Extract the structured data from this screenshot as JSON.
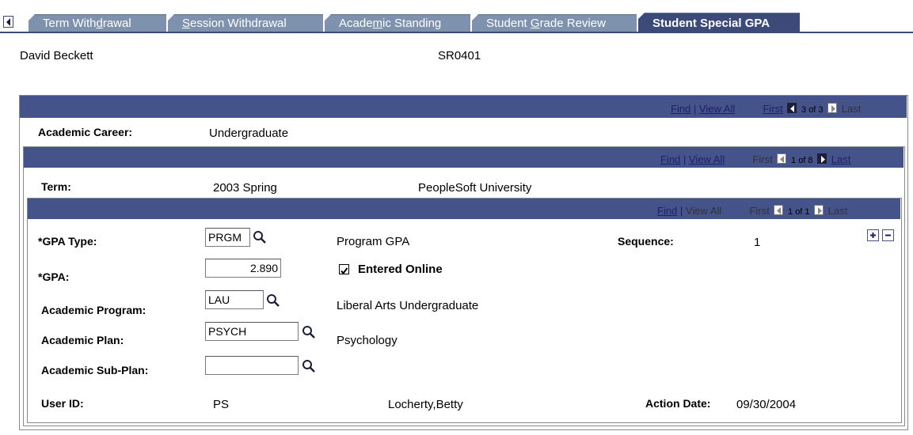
{
  "tabs": [
    {
      "pre": "Term With",
      "u": "d",
      "post": "rawal"
    },
    {
      "pre": "",
      "u": "S",
      "post": "ession Withdrawal"
    },
    {
      "pre": "Acade",
      "u": "m",
      "post": "ic Standing"
    },
    {
      "pre": "Student ",
      "u": "G",
      "post": "rade Review"
    },
    {
      "pre": "Student Special GPA",
      "u": "",
      "post": ""
    }
  ],
  "student": {
    "name": "David Beckett",
    "id": "SR0401"
  },
  "career_grid": {
    "find": "Find",
    "sep": "|",
    "view_all": "View All",
    "first": "First",
    "count": "3 of 3",
    "last": "Last",
    "label": "Academic Career:",
    "value": "Undergraduate"
  },
  "term_grid": {
    "find": "Find",
    "sep": "|",
    "view_all": "View All",
    "first": "First",
    "count": "1 of 8",
    "last": "Last",
    "label": "Term:",
    "value": "2003 Spring",
    "institution": "PeopleSoft University"
  },
  "gpa_grid": {
    "find": "Find",
    "sep": "|",
    "view_all": "View All",
    "first": "First",
    "count": "1 of 1",
    "last": "Last"
  },
  "form": {
    "gpa_type_label": "*GPA Type:",
    "gpa_type_value": "PRGM",
    "gpa_type_desc": "Program GPA",
    "sequence_label": "Sequence:",
    "sequence_value": "1",
    "gpa_label": "*GPA:",
    "gpa_value": "2.890",
    "entered_online_label": "Entered Online",
    "program_label": "Academic Program:",
    "program_value": "LAU",
    "program_desc": "Liberal Arts Undergraduate",
    "plan_label": "Academic Plan:",
    "plan_value": "PSYCH",
    "plan_desc": "Psychology",
    "subplan_label": "Academic Sub-Plan:",
    "subplan_value": "",
    "user_id_label": "User ID:",
    "user_id_value": "PS",
    "user_name": "Locherty,Betty",
    "action_date_label": "Action Date:",
    "action_date_value": "09/30/2004"
  },
  "colors": {
    "bar": "#45538b",
    "tab_active": "#3b4a79",
    "tab_inactive": "#7e91ad",
    "link": "#1d1f6a"
  }
}
